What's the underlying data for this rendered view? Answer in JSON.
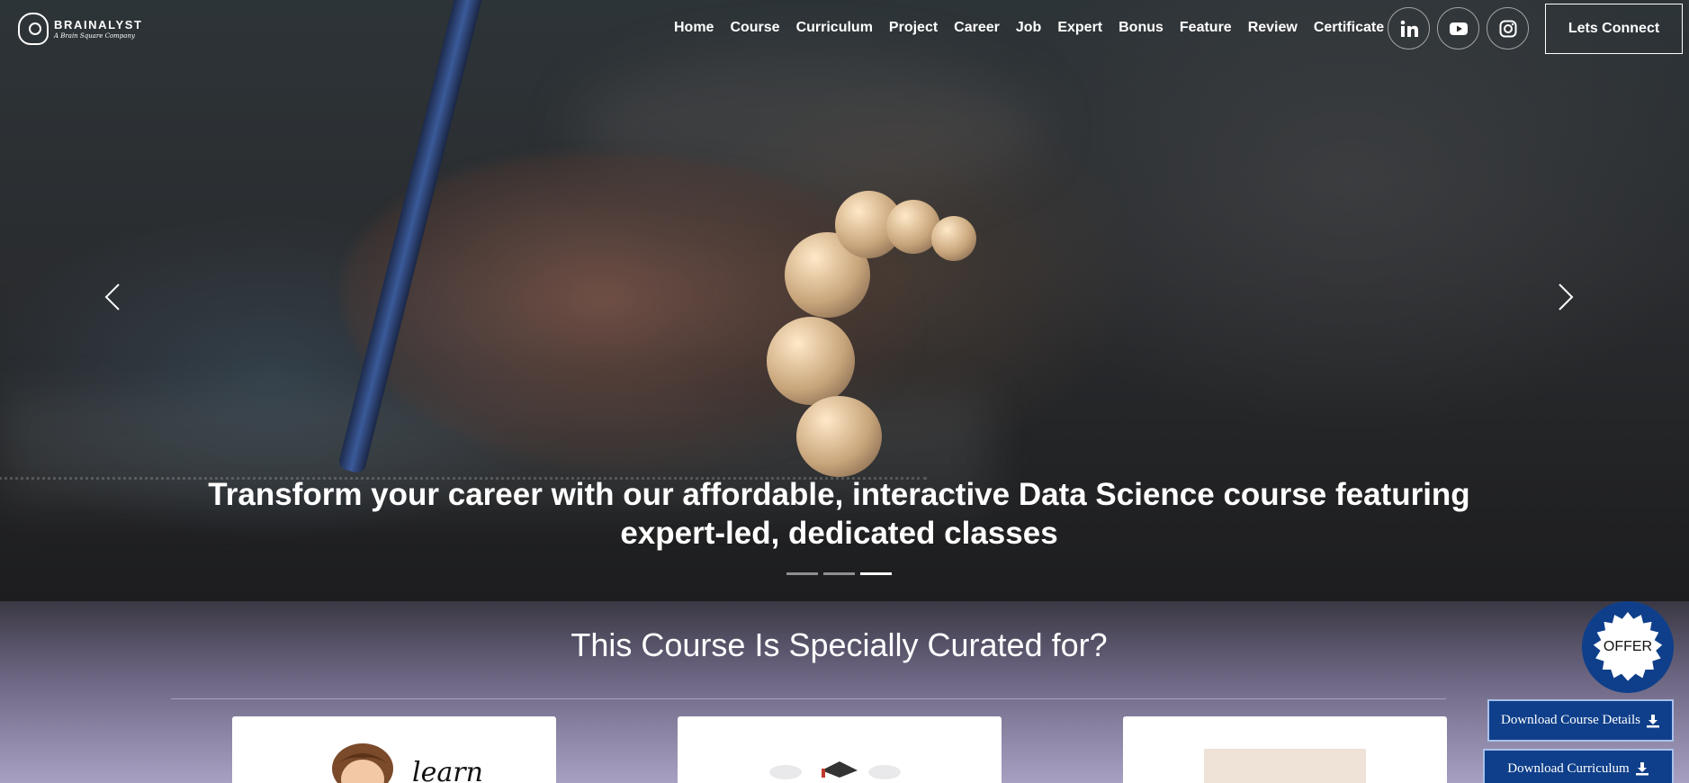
{
  "brand": {
    "name": "BRAINALYST",
    "tagline": "A Brain Square Company"
  },
  "nav": {
    "links": [
      "Home",
      "Course",
      "Curriculum",
      "Project",
      "Career",
      "Job",
      "Expert",
      "Bonus",
      "Feature",
      "Review",
      "Certificate"
    ],
    "socials": [
      "linkedin-icon",
      "youtube-icon",
      "instagram-icon"
    ],
    "cta_label": "Lets Connect"
  },
  "hero": {
    "caption": "Transform your career with our affordable, interactive Data Science course featuring expert-led, dedicated classes",
    "slides": 3,
    "active_slide": 3
  },
  "curated": {
    "title": "This Course Is Specially Curated for?",
    "card_1_text": "learn"
  },
  "widgets": {
    "offer_label": "OFFER",
    "download_details_label": "Download Course Details",
    "download_curriculum_label": "Download Curriculum"
  },
  "colors": {
    "accent": "#0f3f8a",
    "hero_text": "#ffffff"
  }
}
